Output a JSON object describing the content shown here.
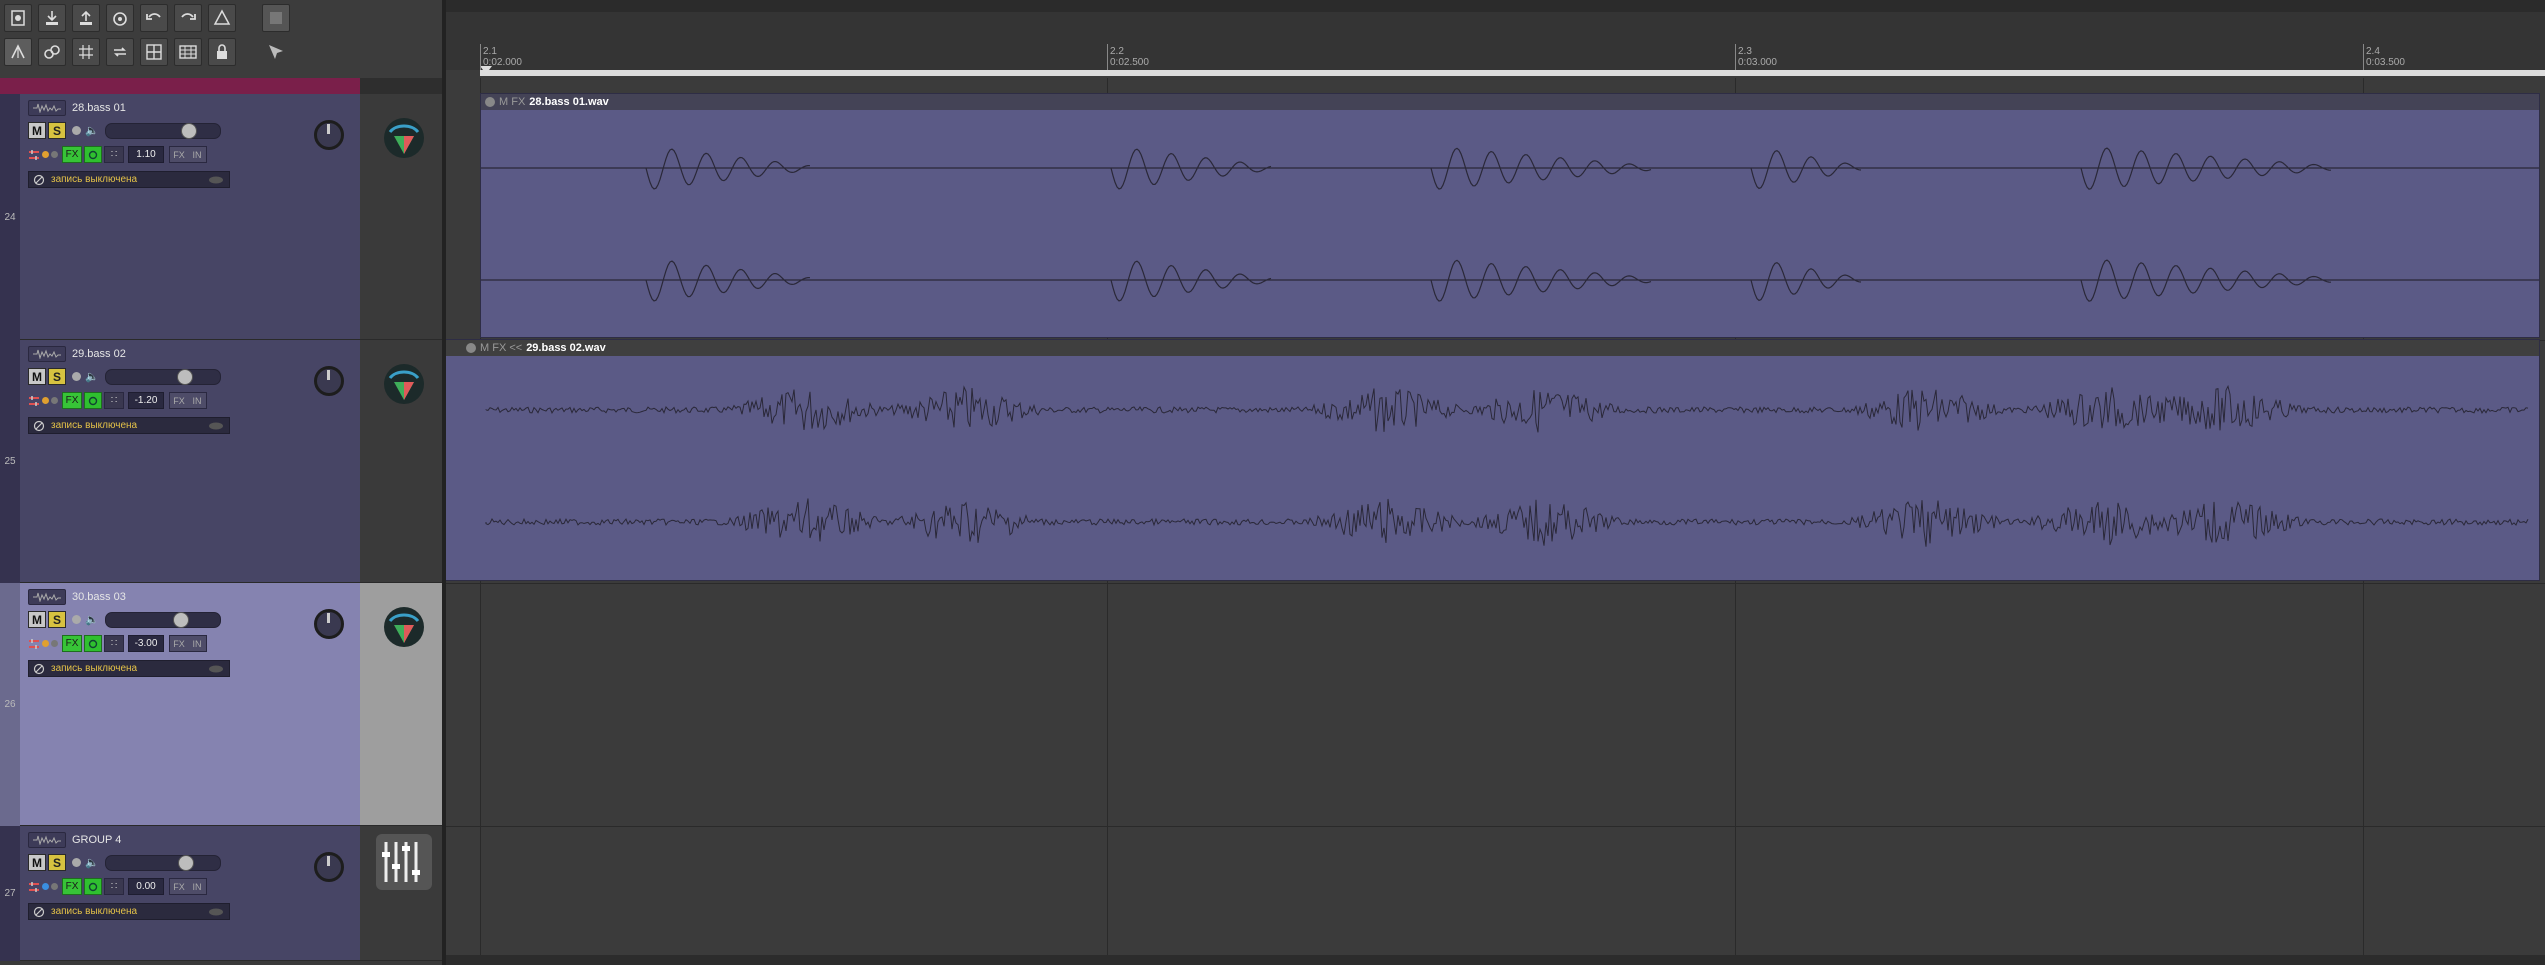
{
  "toolbar": {
    "row1": [
      "metronome-icon",
      "save-icon",
      "open-icon",
      "render-icon",
      "undo-icon",
      "redo-icon",
      "triangle-icon",
      "square-icon"
    ],
    "row2": [
      "grid-icon",
      "link-icon",
      "snap-icon",
      "loop-icon",
      "grid-large-icon",
      "grid-small-icon",
      "lock-icon",
      "ripple-icon"
    ]
  },
  "ruler": {
    "markers": [
      {
        "bar": "2.1",
        "time": "0:02.000"
      },
      {
        "bar": "2.2",
        "time": "0:02.500"
      },
      {
        "bar": "2.3",
        "time": "0:03.000"
      },
      {
        "bar": "2.4",
        "time": "0:03.500"
      }
    ]
  },
  "tracks": [
    {
      "number": "24",
      "name": "28.bass 01",
      "volume": "1.10",
      "fader": 0.78,
      "record_label": "запись выключена",
      "selected": false
    },
    {
      "number": "25",
      "name": "29.bass 02",
      "volume": "-1.20",
      "fader": 0.74,
      "record_label": "запись выключена",
      "selected": false
    },
    {
      "number": "26",
      "name": "30.bass 03",
      "volume": "-3.00",
      "fader": 0.7,
      "record_label": "запись выключена",
      "selected": true
    },
    {
      "number": "27",
      "name": "GROUP 4",
      "volume": "0.00",
      "fader": 0.75,
      "record_label": "запись выключена",
      "selected": false
    }
  ],
  "labels": {
    "mute": "M",
    "solo": "S",
    "fx": "FX",
    "fx_small": "FX",
    "in": "IN"
  },
  "items": [
    {
      "prefix": "M FX",
      "title": "28.bass 01.wav"
    },
    {
      "prefix": "M FX <<",
      "title": "29.bass 02.wav"
    }
  ],
  "colors": {
    "track_panel": "#474565",
    "selected_panel": "#8583b0",
    "item": "#5b5a86",
    "fx_green": "#37c437",
    "solo_yellow": "#d7c240"
  }
}
